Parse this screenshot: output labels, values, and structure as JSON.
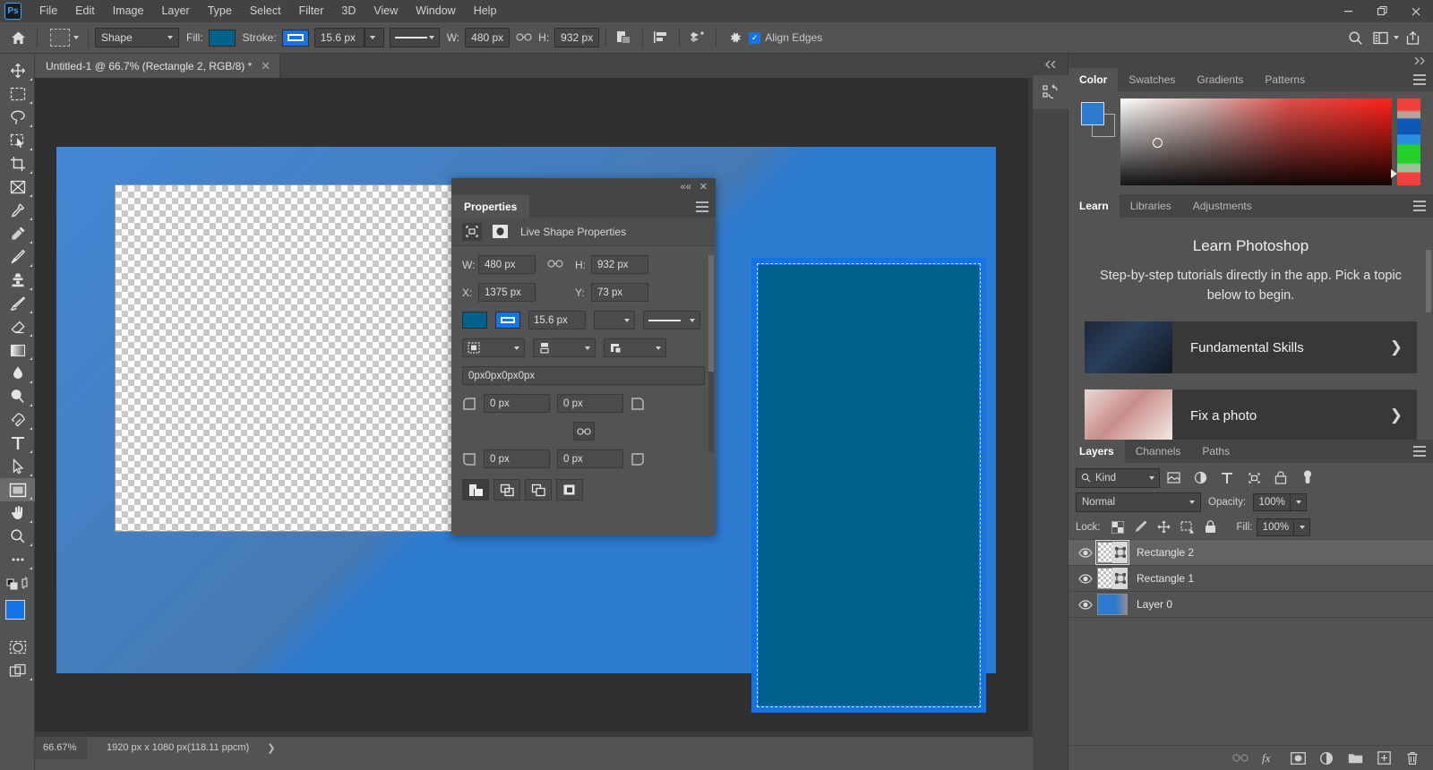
{
  "app": {
    "name": "Adobe Photoshop",
    "logo_text": "Ps"
  },
  "titlebar": {
    "menus": [
      "File",
      "Edit",
      "Image",
      "Layer",
      "Type",
      "Select",
      "Filter",
      "3D",
      "View",
      "Window",
      "Help"
    ],
    "window_controls": [
      {
        "name": "minimize-button",
        "glyph": "—"
      },
      {
        "name": "restore-button",
        "glyph": "❐"
      },
      {
        "name": "close-button",
        "glyph": "✕"
      }
    ]
  },
  "options_bar": {
    "home_icon": "home-icon",
    "tool_preset_label": "shape-tool-preset",
    "mode_value": "Shape",
    "fill_label": "Fill:",
    "fill_color": "#00618c",
    "stroke_label": "Stroke:",
    "stroke_color": "#1473e6",
    "stroke_width": "15.6 px",
    "stroke_style": "solid-line",
    "w_label": "W:",
    "w_value": "480 px",
    "link_icon": "link-wh-icon",
    "h_label": "H:",
    "h_value": "932 px",
    "path_ops_icon": "path-operations-icon",
    "path_align_icon": "path-alignment-icon",
    "path_arrange_icon": "path-arrangement-icon",
    "settings_icon": "gear-icon",
    "align_edges_label": "Align Edges",
    "align_edges_checked": true,
    "right_icons": [
      "search-icon",
      "workspace-icon",
      "chevron-down-icon",
      "share-icon"
    ]
  },
  "toolbar": {
    "tools": [
      {
        "name": "move-tool",
        "glyph": "move"
      },
      {
        "name": "rectangular-marquee-tool",
        "glyph": "marquee"
      },
      {
        "name": "lasso-tool",
        "glyph": "lasso"
      },
      {
        "name": "object-selection-tool",
        "glyph": "objsel"
      },
      {
        "name": "crop-tool",
        "glyph": "crop"
      },
      {
        "name": "frame-tool",
        "glyph": "frame"
      },
      {
        "name": "eyedropper-tool",
        "glyph": "eyedropper"
      },
      {
        "name": "spot-healing-brush-tool",
        "glyph": "heal"
      },
      {
        "name": "brush-tool",
        "glyph": "brush"
      },
      {
        "name": "clone-stamp-tool",
        "glyph": "stamp"
      },
      {
        "name": "history-brush-tool",
        "glyph": "historybrush"
      },
      {
        "name": "eraser-tool",
        "glyph": "eraser"
      },
      {
        "name": "gradient-tool",
        "glyph": "gradient"
      },
      {
        "name": "blur-tool",
        "glyph": "blur"
      },
      {
        "name": "dodge-tool",
        "glyph": "dodge"
      },
      {
        "name": "pen-tool",
        "glyph": "pen"
      },
      {
        "name": "type-tool",
        "glyph": "type"
      },
      {
        "name": "path-selection-tool",
        "glyph": "pathsel"
      },
      {
        "name": "rectangle-tool",
        "glyph": "rectangle",
        "active": true
      },
      {
        "name": "hand-tool",
        "glyph": "hand"
      },
      {
        "name": "zoom-tool",
        "glyph": "zoom"
      },
      {
        "name": "edit-toolbar-button",
        "glyph": "dots"
      }
    ],
    "foreground_color": "#1473e6",
    "background_color": "#8d8d8d",
    "quickmask_icon": "quick-mask-icon",
    "screenmode_icon": "screen-mode-icon"
  },
  "document": {
    "tab_title": "Untitled-1 @ 66.7% (Rectangle 2, RGB/8) *",
    "close_glyph": "✕"
  },
  "statusbar": {
    "zoom": "66.67%",
    "doc_info": "1920 px x 1080 px(118.11 ppcm)",
    "arrow": "❯"
  },
  "properties_panel": {
    "title": "Properties",
    "collapse_glyph": "««",
    "close_glyph": "✕",
    "section_label": "Live Shape Properties",
    "w_label": "W:",
    "w_value": "480 px",
    "chain_icon": "link-icon",
    "h_label": "H:",
    "h_value": "932 px",
    "x_label": "X:",
    "x_value": "1375 px",
    "y_label": "Y:",
    "y_value": "73 px",
    "fill_color": "#00618c",
    "stroke_color": "#1473e6",
    "stroke_width": "15.6 px",
    "stroke_style": "solid-line",
    "stroke_align": "stroke-align-center",
    "stroke_cap": "stroke-cap-butt",
    "stroke_corner": "stroke-corner-miter",
    "radius_summary": "0px0px0px0px",
    "corner_tl": "0 px",
    "corner_tr": "0 px",
    "corner_bl": "0 px",
    "corner_br": "0 px",
    "link_corners_icon": "link-corners-icon",
    "path_ops": [
      "new-layer-op",
      "combine-shapes-op",
      "subtract-front-op",
      "intersect-shapes-op"
    ]
  },
  "right_dock": {
    "strip": {
      "collapse_glyph": "««",
      "buttons": [
        "history-panel-icon"
      ]
    },
    "color_group": {
      "tabs": [
        "Color",
        "Swatches",
        "Gradients",
        "Patterns"
      ],
      "active_tab": "Color",
      "foreground_color": "#2d7ad1",
      "background_color": "#ffffff",
      "menu_icon": "panel-menu-icon"
    },
    "learn_group": {
      "tabs": [
        "Learn",
        "Libraries",
        "Adjustments"
      ],
      "active_tab": "Learn",
      "heading": "Learn Photoshop",
      "subheading": "Step-by-step tutorials directly in the app. Pick a topic below to begin.",
      "cards": [
        {
          "label": "Fundamental Skills",
          "chevron": "❯"
        },
        {
          "label": "Fix a photo",
          "chevron": "❯"
        }
      ],
      "menu_icon": "panel-menu-icon"
    },
    "layers_group": {
      "tabs": [
        "Layers",
        "Channels",
        "Paths"
      ],
      "active_tab": "Layers",
      "menu_icon": "panel-menu-icon",
      "filter_label": "Kind",
      "filter_icons": [
        "filter-pixel-icon",
        "filter-adjustment-icon",
        "filter-type-icon",
        "filter-shape-icon",
        "filter-smart-object-icon",
        "filter-toggle-icon"
      ],
      "blend_mode": "Normal",
      "opacity_label": "Opacity:",
      "opacity_value": "100%",
      "lock_label": "Lock:",
      "lock_icons": [
        "lock-transparent-pixels-icon",
        "lock-image-pixels-icon",
        "lock-position-icon",
        "lock-artboard-nesting-icon",
        "lock-all-icon"
      ],
      "fill_label": "Fill:",
      "fill_value": "100%",
      "layers": [
        {
          "name": "Rectangle 2",
          "visible": true,
          "selected": true,
          "thumb": "vector"
        },
        {
          "name": "Rectangle 1",
          "visible": true,
          "selected": false,
          "thumb": "vector"
        },
        {
          "name": "Layer 0",
          "visible": true,
          "selected": false,
          "thumb": "raster"
        }
      ],
      "bottom_icons": [
        "link-layers-icon",
        "layer-style-fx-icon",
        "add-layer-mask-icon",
        "new-adjustment-layer-icon",
        "new-group-icon",
        "new-layer-icon",
        "delete-layer-icon"
      ]
    }
  },
  "canvas": {
    "artboard_color": "#2d7ad1",
    "shape_fill": "#00618c",
    "shape_stroke": "#1473e6"
  }
}
